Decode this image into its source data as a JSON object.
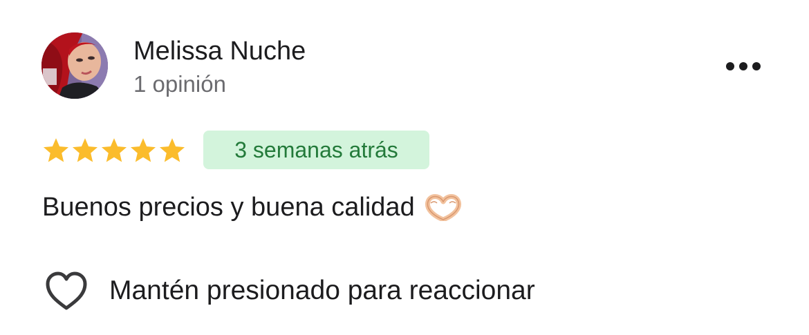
{
  "review": {
    "author": {
      "name": "Melissa Nuche",
      "meta": "1 opinión",
      "avatar_icon": "profile-photo-avatar"
    },
    "more_icon": "more-horizontal-icon",
    "rating": {
      "value": 5,
      "max": 5,
      "star_color": "#fbbc2c"
    },
    "time_ago": "3 semanas atrás",
    "text": "Buenos precios y buena calidad",
    "emoji": "heart-hands-emoji",
    "reaction": {
      "icon": "heart-outline-icon",
      "label": "Mantén presionado para reaccionar"
    }
  },
  "colors": {
    "badge_background": "#d3f4dc",
    "badge_text": "#237a3a",
    "primary_text": "#1c1c1e",
    "secondary_text": "#6b6b6f"
  }
}
